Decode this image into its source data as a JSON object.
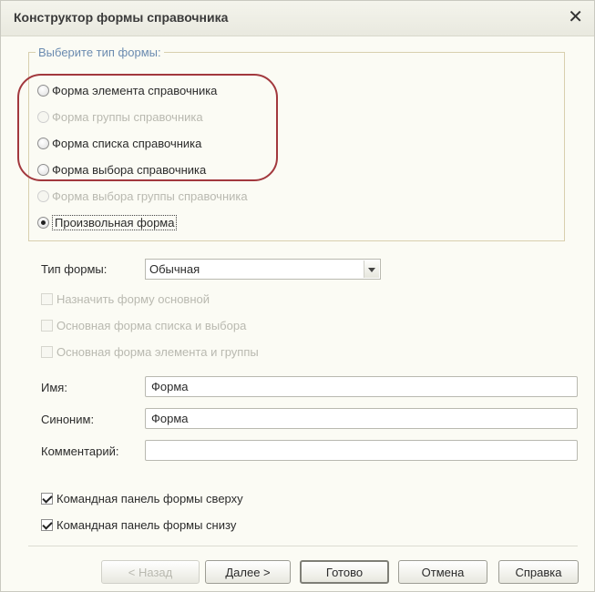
{
  "dialog": {
    "title": "Конструктор формы справочника",
    "close_label": "✕"
  },
  "form_type_group": {
    "legend": "Выберите тип формы:",
    "options": [
      {
        "label": "Форма элемента справочника",
        "enabled": true,
        "selected": false
      },
      {
        "label": "Форма группы справочника",
        "enabled": false,
        "selected": false
      },
      {
        "label": "Форма списка справочника",
        "enabled": true,
        "selected": false
      },
      {
        "label": "Форма выбора справочника",
        "enabled": true,
        "selected": false
      },
      {
        "label": "Форма выбора группы справочника",
        "enabled": false,
        "selected": false
      },
      {
        "label": "Произвольная форма",
        "enabled": true,
        "selected": true
      }
    ]
  },
  "form_kind": {
    "label": "Тип формы:",
    "value": "Обычная"
  },
  "checkboxes": [
    {
      "label": "Назначить форму основной",
      "enabled": false,
      "checked": false
    },
    {
      "label": "Основная форма списка и выбора",
      "enabled": false,
      "checked": false
    },
    {
      "label": "Основная форма элемента и группы",
      "enabled": false,
      "checked": false
    }
  ],
  "fields": {
    "name": {
      "label": "Имя:",
      "value": "Форма"
    },
    "synonym": {
      "label": "Синоним:",
      "value": "Форма"
    },
    "comment": {
      "label": "Комментарий:",
      "value": ""
    }
  },
  "panel_options": [
    {
      "label": "Командная панель формы сверху",
      "checked": true
    },
    {
      "label": "Командная панель формы снизу",
      "checked": true
    }
  ],
  "buttons": {
    "back": "< Назад",
    "next": "Далее >",
    "finish": "Готово",
    "cancel": "Отмена",
    "help": "Справка"
  },
  "colors": {
    "highlight_oval": "#a2383d",
    "legend_text": "#6b8bb0"
  }
}
